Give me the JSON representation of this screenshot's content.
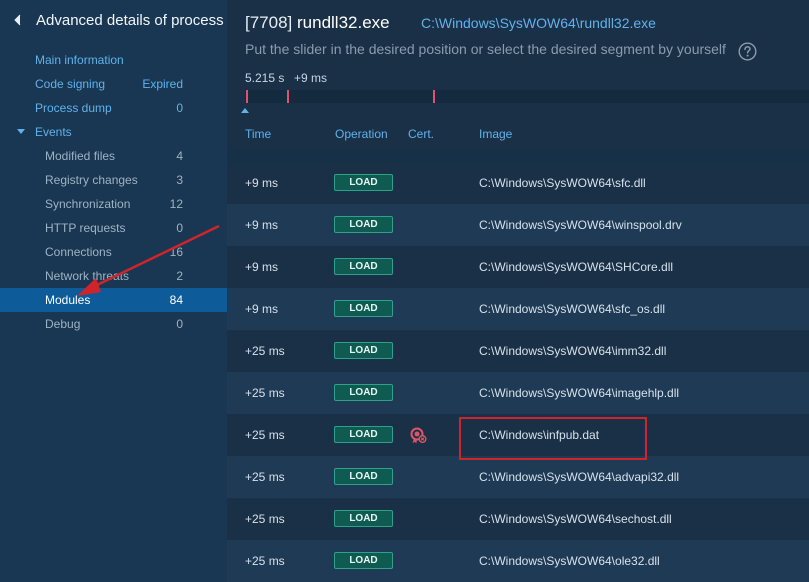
{
  "sidebar": {
    "title": "Advanced details of process",
    "items": [
      {
        "label": "Main information",
        "value": ""
      },
      {
        "label": "Code signing",
        "value": "Expired"
      },
      {
        "label": "Process dump",
        "value": "0"
      },
      {
        "label": "Events",
        "value": ""
      },
      {
        "label": "Modified files",
        "value": "4"
      },
      {
        "label": "Registry changes",
        "value": "3"
      },
      {
        "label": "Synchronization",
        "value": "12"
      },
      {
        "label": "HTTP requests",
        "value": "0"
      },
      {
        "label": "Connections",
        "value": "16"
      },
      {
        "label": "Network threats",
        "value": "2"
      },
      {
        "label": "Modules",
        "value": "84"
      },
      {
        "label": "Debug",
        "value": "0"
      }
    ]
  },
  "header": {
    "pid": "[7708]",
    "process_name": "rundll32.exe",
    "path": "C:\\Windows\\SysWOW64\\rundll32.exe",
    "hint": "Put the slider in the desired position or select the desired segment by yourself"
  },
  "timeline": {
    "start_label": "5.215 s",
    "offset_label": "+9 ms"
  },
  "columns": {
    "time": "Time",
    "operation": "Operation",
    "cert": "Cert.",
    "image": "Image"
  },
  "rows": [
    {
      "time": "+9 ms",
      "op": "LOAD",
      "image": "C:\\Windows\\SysWOW64\\sfc.dll",
      "cert": false
    },
    {
      "time": "+9 ms",
      "op": "LOAD",
      "image": "C:\\Windows\\SysWOW64\\winspool.drv",
      "cert": false
    },
    {
      "time": "+9 ms",
      "op": "LOAD",
      "image": "C:\\Windows\\SysWOW64\\SHCore.dll",
      "cert": false
    },
    {
      "time": "+9 ms",
      "op": "LOAD",
      "image": "C:\\Windows\\SysWOW64\\sfc_os.dll",
      "cert": false
    },
    {
      "time": "+25 ms",
      "op": "LOAD",
      "image": "C:\\Windows\\SysWOW64\\imm32.dll",
      "cert": false
    },
    {
      "time": "+25 ms",
      "op": "LOAD",
      "image": "C:\\Windows\\SysWOW64\\imagehlp.dll",
      "cert": false
    },
    {
      "time": "+25 ms",
      "op": "LOAD",
      "image": "C:\\Windows\\infpub.dat",
      "cert": true
    },
    {
      "time": "+25 ms",
      "op": "LOAD",
      "image": "C:\\Windows\\SysWOW64\\advapi32.dll",
      "cert": false
    },
    {
      "time": "+25 ms",
      "op": "LOAD",
      "image": "C:\\Windows\\SysWOW64\\sechost.dll",
      "cert": false
    },
    {
      "time": "+25 ms",
      "op": "LOAD",
      "image": "C:\\Windows\\SysWOW64\\ole32.dll",
      "cert": false
    }
  ],
  "colors": {
    "accent": "#5fb2ec",
    "active_item": "#0d5c99",
    "load_badge": "#0f5b52",
    "highlight": "#d0242a"
  }
}
